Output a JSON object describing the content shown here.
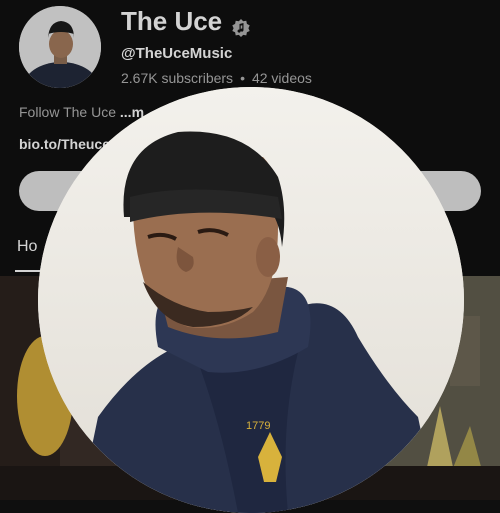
{
  "channel": {
    "name": "The Uce",
    "handle": "@TheUceMusic",
    "subscribers": "2.67K subscribers",
    "separator": "•",
    "videos": "42 videos",
    "description_prefix": "Follow The Uce ",
    "description_more": "...m",
    "link": "bio.to/Theuce"
  },
  "tabs": [
    {
      "label": "Ho"
    }
  ],
  "icons": {
    "verified": "verified-music-note-icon"
  },
  "colors": {
    "background": "#0f0f0f",
    "text_primary": "#f1f1f1",
    "text_secondary": "#aaaaaa",
    "button": "#d9d9d9"
  }
}
